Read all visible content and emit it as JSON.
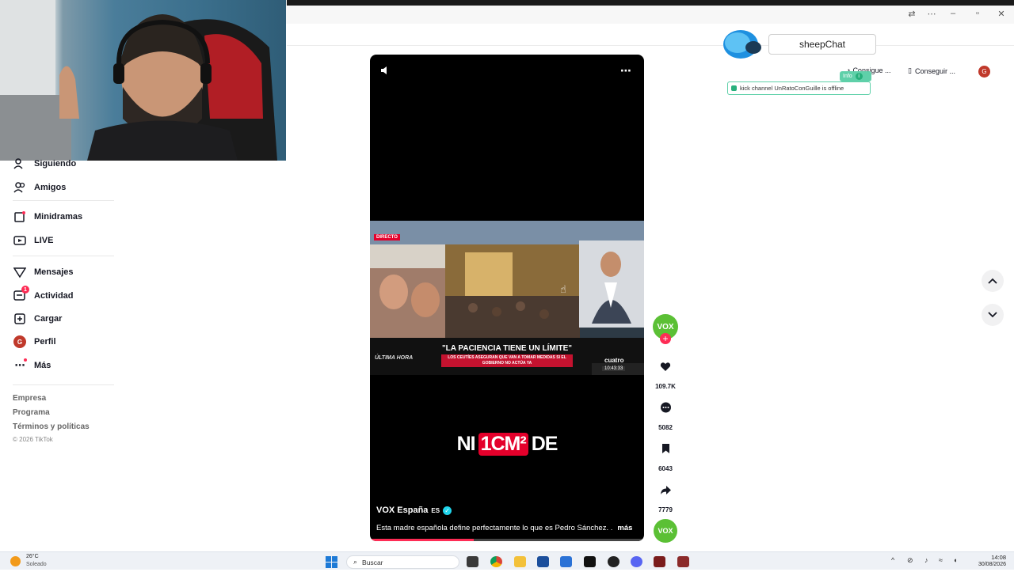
{
  "window": {
    "controls": [
      "minimize",
      "maximize",
      "close"
    ]
  },
  "overlay": {
    "sheepchat_label": "sheepChat",
    "consigue1": "Consigue ...",
    "consigue2": "Conseguir ...",
    "info_label": "Info",
    "kick_status": "kick channel UnRatoConGuille is offline",
    "avatar_letter": "G"
  },
  "sidebar": {
    "items": [
      {
        "label": "Siguiendo",
        "icon": "following-icon"
      },
      {
        "label": "Amigos",
        "icon": "friends-icon"
      },
      {
        "label": "Minidramas",
        "icon": "minidramas-icon"
      },
      {
        "label": "LIVE",
        "icon": "live-icon"
      },
      {
        "label": "Mensajes",
        "icon": "messages-icon"
      },
      {
        "label": "Actividad",
        "icon": "activity-icon",
        "badge": "1"
      },
      {
        "label": "Cargar",
        "icon": "upload-icon"
      },
      {
        "label": "Perfil",
        "icon": "profile-avatar",
        "avatar_letter": "G"
      },
      {
        "label": "Más",
        "icon": "more-icon"
      }
    ],
    "footer": [
      "Empresa",
      "Programa",
      "Términos y políticas",
      "© 2026 TikTok"
    ]
  },
  "video": {
    "clip_badge": "DIRECTO",
    "clip_headline": "\"LA PACIENCIA TIENE UN LÍMITE\"",
    "clip_subline": "LOS CEUTÍES ASEGURAN QUE VAN A TOMAR MEDIDAS SI EL GOBIERNO NO ACTÚA YA",
    "clip_ticker": "ÚLTIMA HORA",
    "clip_channel": "cuatro",
    "clip_time": "10:43:33",
    "caption_part1": "NI",
    "caption_part2": "1CM²",
    "caption_part3": "DE",
    "author": "VOX España",
    "author_tag": "ES",
    "description": "Esta madre española define perfectamente lo que es Pedro Sánchez. .",
    "more_label": "más",
    "progress": 0.38
  },
  "actions": {
    "avatar_text": "VOX",
    "likes": "109.7K",
    "comments": "5082",
    "saves": "6043",
    "shares": "7779",
    "sound_avatar_text": "VOX"
  },
  "taskbar": {
    "weather_temp": "26°C",
    "weather_desc": "Soleado",
    "search_placeholder": "Buscar",
    "time": "14:08",
    "date": "30/08/2026"
  },
  "colors": {
    "accent": "#fe2c55",
    "vox_green": "#5bc035",
    "verified": "#20d5ec"
  }
}
